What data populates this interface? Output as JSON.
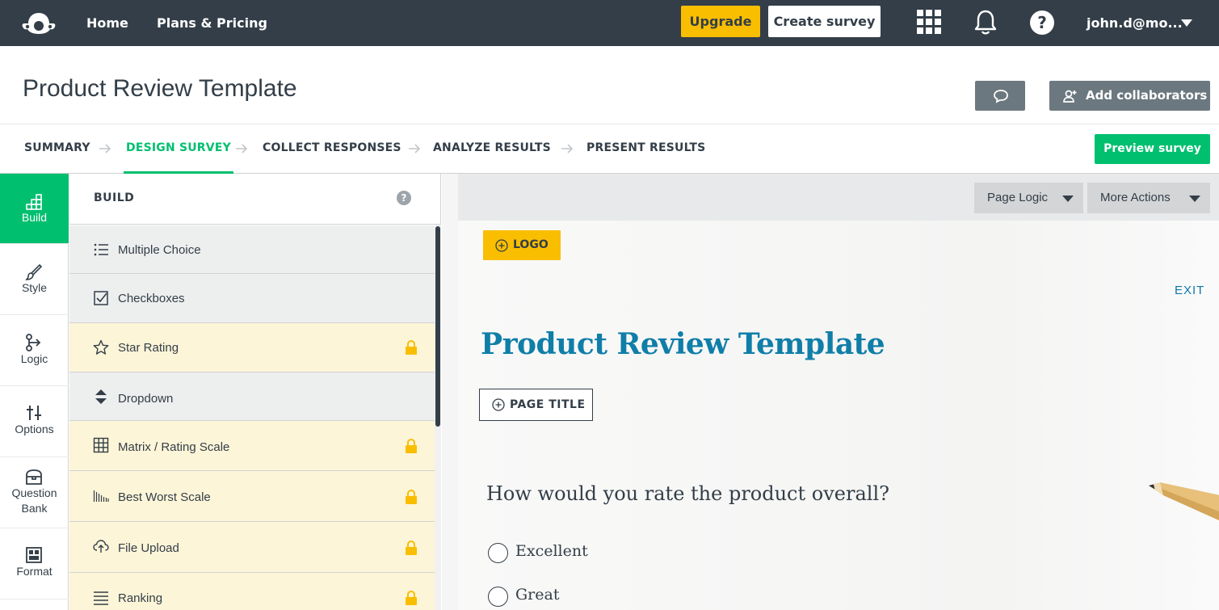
{
  "topnav": {
    "home": "Home",
    "plans": "Plans & Pricing",
    "upgrade": "Upgrade",
    "create_survey": "Create survey",
    "user": "john.d@mo...",
    "colors": {
      "bg": "#333e48",
      "upgrade": "#f9be00"
    },
    "icons": [
      "apps-grid-icon",
      "bell-icon",
      "help-icon",
      "caret-down-icon"
    ]
  },
  "header": {
    "title": "Product Review Template",
    "add_collaborators": "Add collaborators"
  },
  "steps": {
    "items": [
      "SUMMARY",
      "DESIGN SURVEY",
      "COLLECT RESPONSES",
      "ANALYZE RESULTS",
      "PRESENT RESULTS"
    ],
    "active": "DESIGN SURVEY",
    "preview": "Preview survey",
    "accent": "#00bf6f"
  },
  "rail": {
    "items": [
      {
        "label": "Build",
        "icon": "build-blocks-icon",
        "active": true
      },
      {
        "label": "Style",
        "icon": "brush-icon",
        "active": false
      },
      {
        "label": "Logic",
        "icon": "logic-branch-icon",
        "active": false
      },
      {
        "label": "Options",
        "icon": "sliders-icon",
        "active": false
      },
      {
        "label": "Question Bank",
        "line1": "Question",
        "line2": "Bank",
        "icon": "question-bank-icon",
        "active": false
      },
      {
        "label": "Format",
        "icon": "format-layout-icon",
        "active": false
      }
    ]
  },
  "build": {
    "title": "BUILD",
    "help": "?",
    "items": [
      {
        "label": "Multiple Choice",
        "icon": "list-icon",
        "locked": false
      },
      {
        "label": "Checkboxes",
        "icon": "checkbox-icon",
        "locked": false
      },
      {
        "label": "Star Rating",
        "icon": "star-icon",
        "locked": true
      },
      {
        "label": "Dropdown",
        "icon": "dropdown-arrows-icon",
        "locked": false
      },
      {
        "label": "Matrix / Rating Scale",
        "icon": "matrix-grid-icon",
        "locked": true
      },
      {
        "label": "Best Worst Scale",
        "icon": "best-worst-scale-icon",
        "locked": true
      },
      {
        "label": "File Upload",
        "icon": "cloud-upload-icon",
        "locked": true
      },
      {
        "label": "Ranking",
        "icon": "ranking-lines-icon",
        "locked": true
      }
    ]
  },
  "canvas": {
    "page_logic": "Page Logic",
    "more_actions": "More Actions",
    "logo": "LOGO",
    "exit": "EXIT",
    "heading": "Product Review Template",
    "page_title": "PAGE TITLE",
    "question": "How would you rate the product overall?",
    "options": [
      "Excellent",
      "Great"
    ],
    "heading_color": "#0f7ea8"
  }
}
